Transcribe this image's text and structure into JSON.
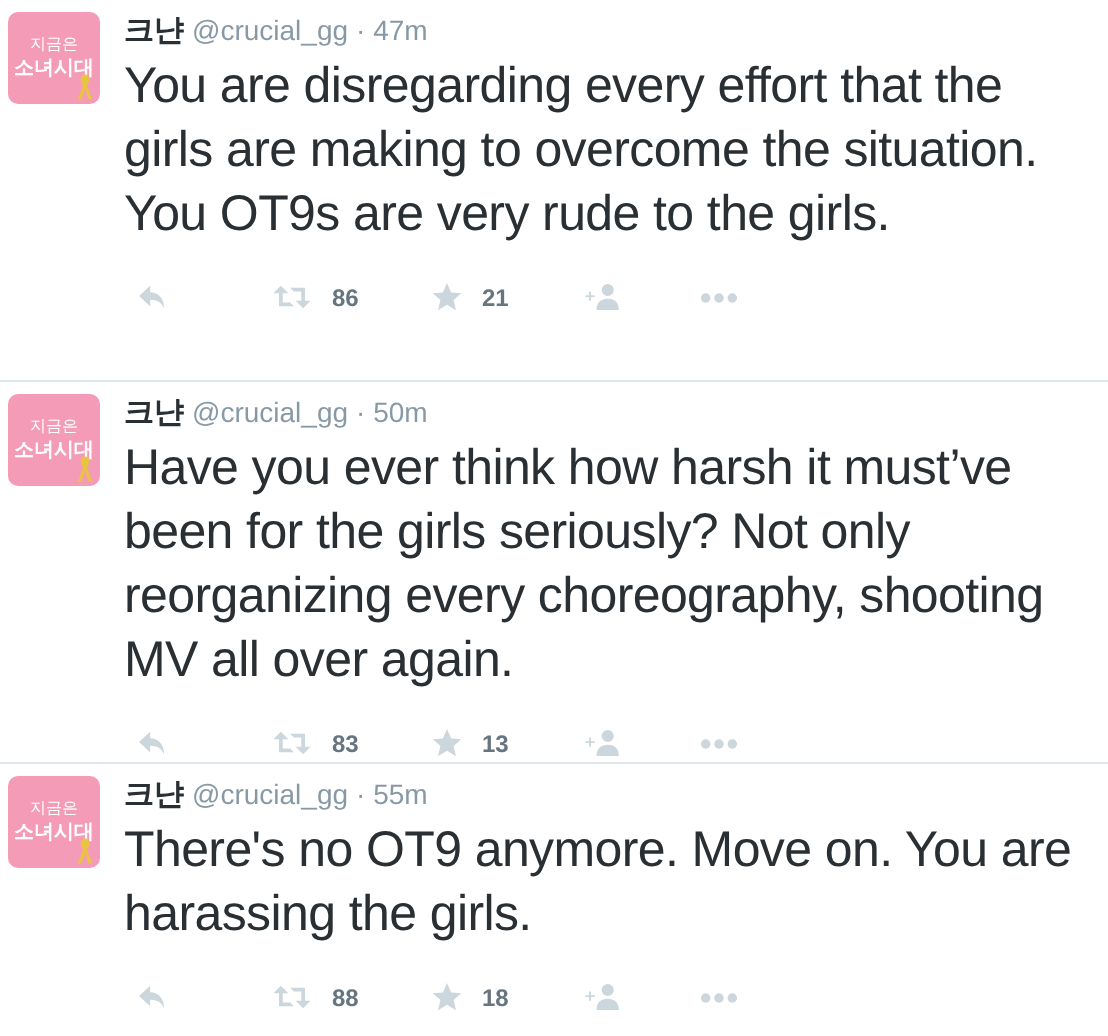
{
  "tweets": [
    {
      "avatar": {
        "line_1": "지금은",
        "line_2": "소녀시대"
      },
      "name": "크냔",
      "handle": "@crucial_gg",
      "time": "· 47m",
      "text": "You are disregarding every effort that the girls are making to overcome the situation. You OT9s are very rude to the girls.",
      "retweets": "86",
      "favorites": "21"
    },
    {
      "avatar": {
        "line_1": "지금은",
        "line_2": "소녀시대"
      },
      "name": "크냔",
      "handle": "@crucial_gg",
      "time": "· 50m",
      "text": "Have you ever think how harsh it must’ve been for the girls seriously? Not only reorganizing every choreography, shooting MV all over again.",
      "retweets": "83",
      "favorites": "13"
    },
    {
      "avatar": {
        "line_1": "지금은",
        "line_2": "소녀시대"
      },
      "name": "크냔",
      "handle": "@crucial_gg",
      "time": "· 55m",
      "text": "There's no OT9 anymore. Move on. You are harassing the girls.",
      "retweets": "88",
      "favorites": "18"
    }
  ]
}
